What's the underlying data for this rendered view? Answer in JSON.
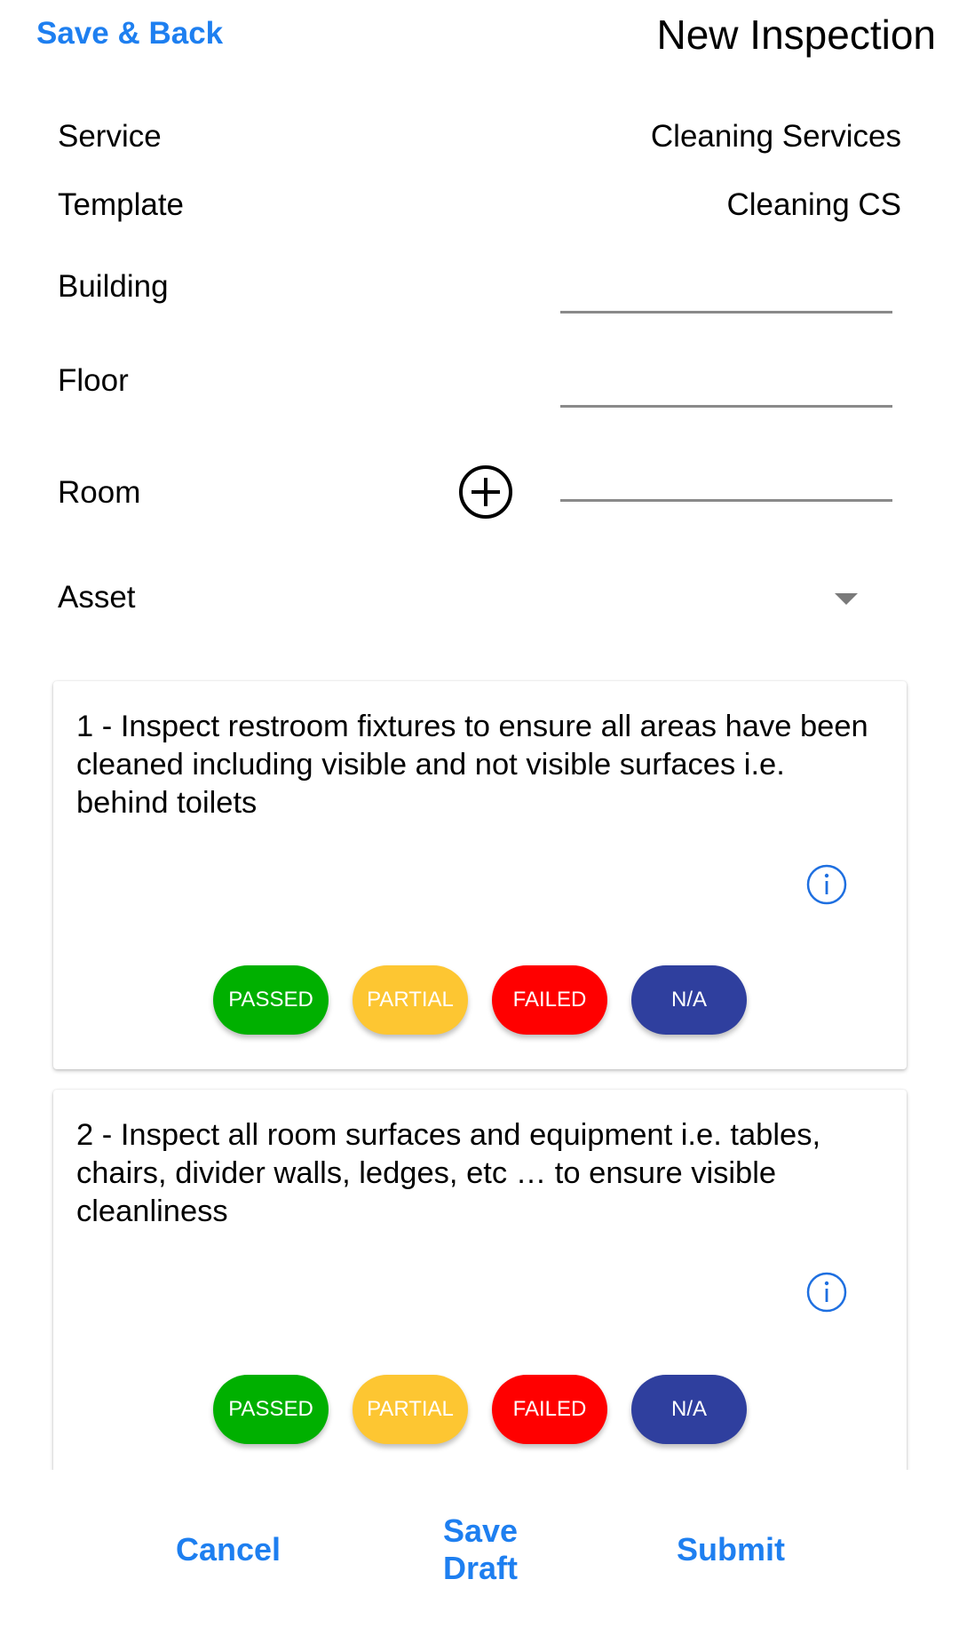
{
  "header": {
    "back_label": "Save & Back",
    "title": "New Inspection"
  },
  "form": {
    "service": {
      "label": "Service",
      "value": "Cleaning Services"
    },
    "template": {
      "label": "Template",
      "value": "Cleaning CS"
    },
    "building": {
      "label": "Building",
      "value": ""
    },
    "floor": {
      "label": "Floor",
      "value": ""
    },
    "room": {
      "label": "Room",
      "value": "",
      "add_icon": "add-circle-icon"
    },
    "asset": {
      "label": "Asset",
      "value": "",
      "dropdown_icon": "caret-down-icon"
    }
  },
  "colors": {
    "accent": "#1e7ff0",
    "passed": "#00b000",
    "partial": "#fdc632",
    "failed": "#ff0000",
    "na": "#2f3f9e"
  },
  "items": [
    {
      "text": "1 - Inspect restroom fixtures to ensure all areas have been cleaned including visible and not visible surfaces i.e. behind toilets",
      "info_icon": "info-icon",
      "buttons": [
        "PASSED",
        "PARTIAL",
        "FAILED",
        "N/A"
      ]
    },
    {
      "text": "2 - Inspect all room surfaces and equipment i.e. tables, chairs, divider walls, ledges, etc … to ensure visible cleanliness",
      "info_icon": "info-icon",
      "buttons": [
        "PASSED",
        "PARTIAL",
        "FAILED",
        "N/A"
      ]
    }
  ],
  "footer": {
    "cancel": "Cancel",
    "save_draft_line1": "Save",
    "save_draft_line2": "Draft",
    "submit": "Submit"
  }
}
